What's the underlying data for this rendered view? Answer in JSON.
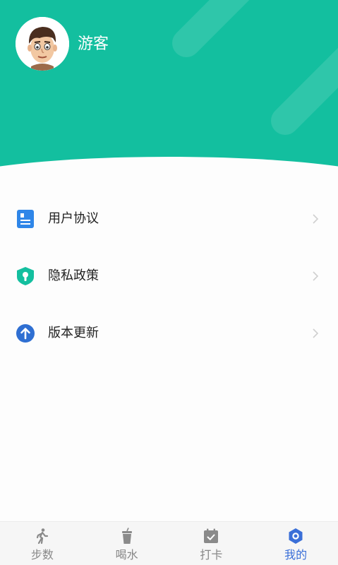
{
  "profile": {
    "username": "游客",
    "avatar_icon": "avatar-icon"
  },
  "menu": {
    "items": [
      {
        "label": "用户协议",
        "icon": "document-icon",
        "color": "#2f86e8"
      },
      {
        "label": "隐私政策",
        "icon": "shield-lock-icon",
        "color": "#13bf9f"
      },
      {
        "label": "版本更新",
        "icon": "upload-arrow-icon",
        "color": "#2f6fd2"
      }
    ]
  },
  "tabbar": {
    "tabs": [
      {
        "label": "步数",
        "icon": "walk-icon",
        "active": false
      },
      {
        "label": "喝水",
        "icon": "cup-icon",
        "active": false
      },
      {
        "label": "打卡",
        "icon": "calendar-check-icon",
        "active": false
      },
      {
        "label": "我的",
        "icon": "hexagon-user-icon",
        "active": true
      }
    ]
  },
  "colors": {
    "accent": "#13bf9f",
    "active_tab": "#3a6fd8",
    "inactive_tab": "#888888"
  }
}
